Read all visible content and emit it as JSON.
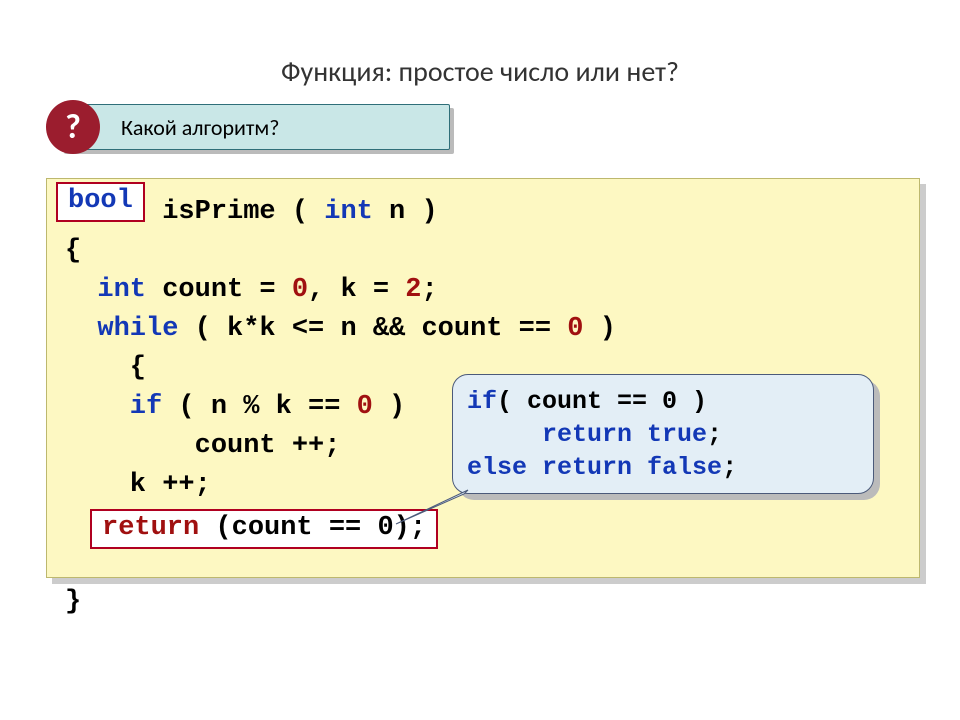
{
  "title": "Функция: простое число или нет?",
  "question_bar": {
    "badge": "?",
    "text": "Какой алгоритм?"
  },
  "bool_badge": "bool",
  "code": {
    "l1_space": "      ",
    "l1_fn": "isPrime",
    "l1_p1": " ( ",
    "l1_int": "int",
    "l1_n": " n )",
    "l2": "{",
    "l3_int": "  int",
    "l3_rest1": " count = ",
    "l3_zero": "0",
    "l3_rest2": ", k = ",
    "l3_two": "2",
    "l3_semi": ";",
    "l4_while": "  while",
    "l4_body": " ( k*k <= n && count == ",
    "l4_zero": "0",
    "l4_end": " )",
    "l5": "    {",
    "l6_if": "    if",
    "l6_body": " ( n % k == ",
    "l6_zero": "0",
    "l6_end": " )",
    "l7": "        count ++;",
    "l8": "    k ++;",
    "l9": "    }",
    "l10_blank": " ",
    "l11": "}"
  },
  "return_box": {
    "ret": "return",
    "rest": " (count == 0);"
  },
  "callout": {
    "l1_if": "if",
    "l1_rest": "( count == 0 )",
    "l2_ret": "     return",
    "l2_true": " true",
    "l2_semi": ";",
    "l3_else": "else",
    "l3_ret": " return",
    "l3_false": " false",
    "l3_semi": ";"
  }
}
